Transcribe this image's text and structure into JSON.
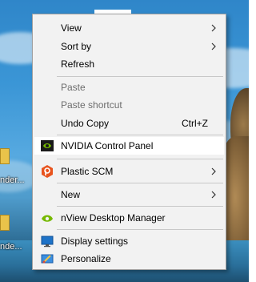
{
  "desktop": {
    "icon_labels": [
      "nder...",
      "nde..."
    ]
  },
  "menu": {
    "items": [
      {
        "label": "View",
        "submenu": true
      },
      {
        "label": "Sort by",
        "submenu": true
      },
      {
        "label": "Refresh"
      },
      {
        "label": "Paste",
        "disabled": true
      },
      {
        "label": "Paste shortcut",
        "disabled": true
      },
      {
        "label": "Undo Copy",
        "shortcut": "Ctrl+Z"
      },
      {
        "label": "NVIDIA Control Panel",
        "icon": "nvidia-icon",
        "highlighted": true
      },
      {
        "label": "Plastic SCM",
        "icon": "plastic-scm-icon",
        "submenu": true
      },
      {
        "label": "New",
        "submenu": true
      },
      {
        "label": "nView Desktop Manager",
        "icon": "nview-icon"
      },
      {
        "label": "Display settings",
        "icon": "display-settings-icon"
      },
      {
        "label": "Personalize",
        "icon": "personalize-icon"
      }
    ]
  },
  "colors": {
    "menu_bg": "#f2f2f2",
    "highlight": "#ffffff",
    "disabled_text": "#6d6d6d",
    "nvidia_green": "#76b900",
    "plastic_orange": "#e8541e"
  }
}
